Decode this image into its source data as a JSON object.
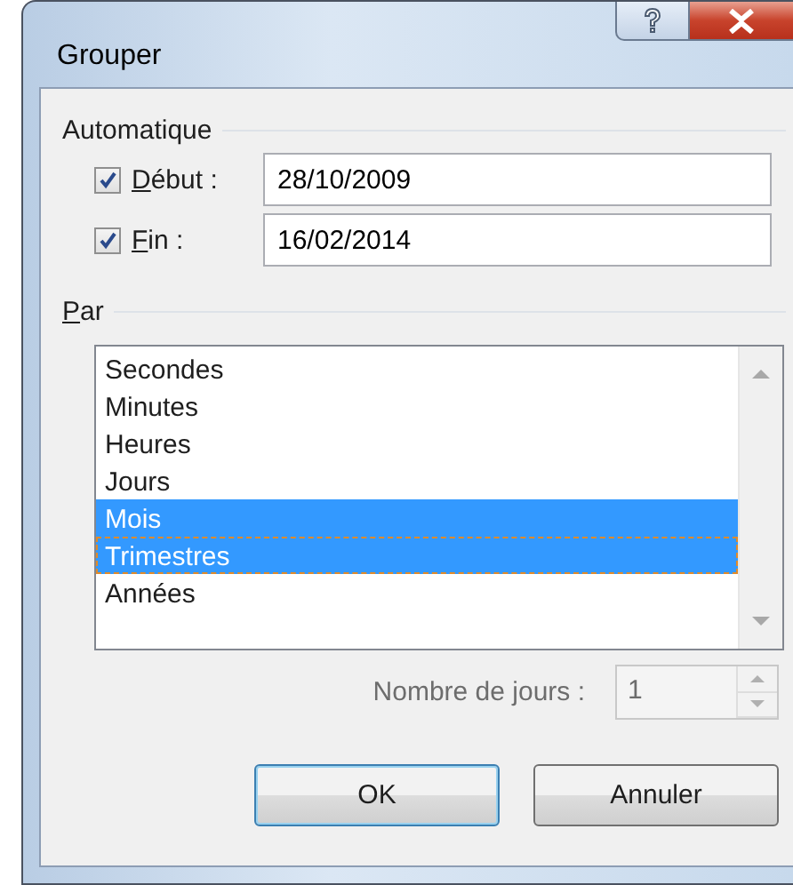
{
  "window": {
    "title": "Grouper"
  },
  "automatique": {
    "label": "Automatique",
    "mnemonic": false,
    "rows": [
      {
        "label": "Début :",
        "mnemonic": true,
        "checked": true,
        "value": "28/10/2009"
      },
      {
        "label": "Fin :",
        "mnemonic": true,
        "checked": true,
        "value": "16/02/2014"
      }
    ]
  },
  "par": {
    "label": "Par",
    "mnemonic": true,
    "items": [
      {
        "label": "Secondes",
        "selected": false,
        "focused": false
      },
      {
        "label": "Minutes",
        "selected": false,
        "focused": false
      },
      {
        "label": "Heures",
        "selected": false,
        "focused": false
      },
      {
        "label": "Jours",
        "selected": false,
        "focused": false
      },
      {
        "label": "Mois",
        "selected": true,
        "focused": false
      },
      {
        "label": "Trimestres",
        "selected": true,
        "focused": true
      },
      {
        "label": "Années",
        "selected": false,
        "focused": false
      }
    ]
  },
  "days": {
    "label": "Nombre de jours :",
    "value": "1",
    "disabled": true
  },
  "buttons": [
    {
      "label": "OK",
      "default": true
    },
    {
      "label": "Annuler",
      "default": false
    }
  ]
}
